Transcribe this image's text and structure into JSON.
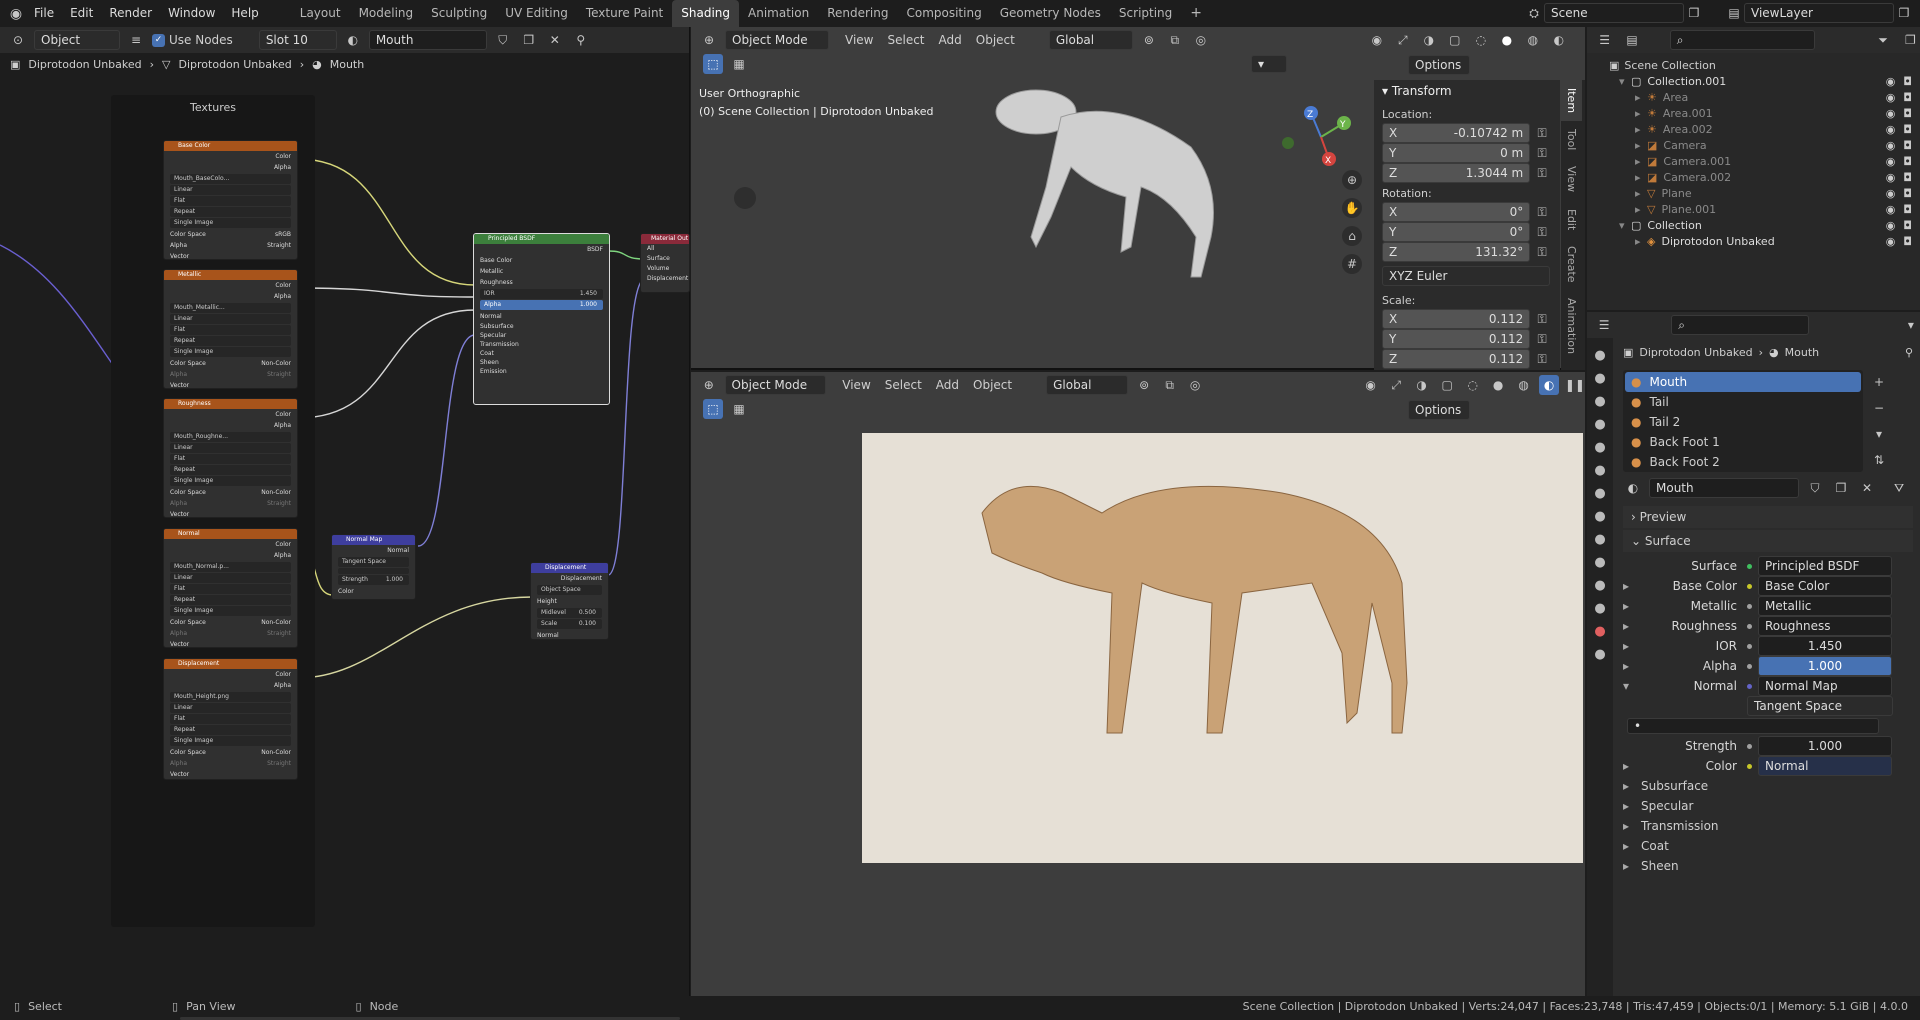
{
  "menu": [
    "File",
    "Edit",
    "Render",
    "Window",
    "Help"
  ],
  "workspaces": [
    "Layout",
    "Modeling",
    "Sculpting",
    "UV Editing",
    "Texture Paint",
    "Shading",
    "Animation",
    "Rendering",
    "Compositing",
    "Geometry Nodes",
    "Scripting"
  ],
  "active_workspace": "Shading",
  "scene": "Scene",
  "view_layer": "ViewLayer",
  "node_editor": {
    "mode": "Object",
    "use_nodes": "Use Nodes",
    "slot": "Slot 10",
    "material": "Mouth",
    "breadcrumb": [
      "Diprotodon Unbaked",
      "Diprotodon Unbaked",
      "Mouth"
    ],
    "frame_label": "Textures",
    "tex_nodes": [
      {
        "title": "Base Color",
        "image": "Mouth_BaseColo...",
        "interp": "Linear",
        "proj": "Flat",
        "ext": "Repeat",
        "src": "Single Image",
        "cs_label": "Color Space",
        "cs": "sRGB",
        "alpha_label": "Alpha",
        "alpha": "Straight"
      },
      {
        "title": "Metallic",
        "image": "Mouth_Metallic...",
        "interp": "Linear",
        "proj": "Flat",
        "ext": "Repeat",
        "src": "Single Image",
        "cs_label": "Color Space",
        "cs": "Non-Color",
        "alpha_label": "Alpha",
        "alpha": "Straight"
      },
      {
        "title": "Roughness",
        "image": "Mouth_Roughne...",
        "interp": "Linear",
        "proj": "Flat",
        "ext": "Repeat",
        "src": "Single Image",
        "cs_label": "Color Space",
        "cs": "Non-Color",
        "alpha_label": "Alpha",
        "alpha": "Straight"
      },
      {
        "title": "Normal",
        "image": "Mouth_Normal.p...",
        "interp": "Linear",
        "proj": "Flat",
        "ext": "Repeat",
        "src": "Single Image",
        "cs_label": "Color Space",
        "cs": "Non-Color",
        "alpha_label": "Alpha",
        "alpha": "Straight"
      },
      {
        "title": "Displacement",
        "image": "Mouth_Height.png",
        "interp": "Linear",
        "proj": "Flat",
        "ext": "Repeat",
        "src": "Single Image",
        "cs_label": "Color Space",
        "cs": "Non-Color",
        "alpha_label": "Alpha",
        "alpha": "Straight"
      }
    ],
    "sock": {
      "color": "Color",
      "alpha": "Alpha",
      "vector": "Vector"
    },
    "bsdf": {
      "title": "Principled BSDF",
      "out": "BSDF",
      "inputs": [
        "Base Color",
        "Metallic",
        "Roughness"
      ],
      "ior_label": "IOR",
      "ior": "1.450",
      "alpha_label": "Alpha",
      "alpha": "1.000",
      "normal": "Normal",
      "panels": [
        "Subsurface",
        "Specular",
        "Transmission",
        "Coat",
        "Sheen",
        "Emission"
      ]
    },
    "matout": {
      "title": "Material Out",
      "inputs": [
        "All",
        "Surface",
        "Volume",
        "Displacement"
      ]
    },
    "normalmap": {
      "title": "Normal Map",
      "out": "Normal",
      "space": "Tangent Space",
      "strength_label": "Strength",
      "strength": "1.000",
      "color": "Color"
    },
    "disp": {
      "title": "Displacement",
      "out": "Displacement",
      "space": "Object Space",
      "inputs": [
        "Height"
      ],
      "mid_label": "Midlevel",
      "mid": "0.500",
      "scale_label": "Scale",
      "scale": "0.100",
      "normal": "Normal"
    }
  },
  "viewport_top": {
    "mode": "Object Mode",
    "menus": [
      "View",
      "Select",
      "Add",
      "Object"
    ],
    "orient": "Global",
    "options": "Options",
    "title": "User Orthographic",
    "subtitle": "(0) Scene Collection | Diprotodon Unbaked",
    "npanel": {
      "header": "Transform",
      "location": "Location:",
      "loc": [
        {
          "a": "X",
          "v": "-0.10742 m"
        },
        {
          "a": "Y",
          "v": "0 m"
        },
        {
          "a": "Z",
          "v": "1.3044 m"
        }
      ],
      "rotation": "Rotation:",
      "rot": [
        {
          "a": "X",
          "v": "0°"
        },
        {
          "a": "Y",
          "v": "0°"
        },
        {
          "a": "Z",
          "v": "131.32°"
        }
      ],
      "euler": "XYZ Euler",
      "scale": "Scale:",
      "scl": [
        {
          "a": "X",
          "v": "0.112"
        },
        {
          "a": "Y",
          "v": "0.112"
        },
        {
          "a": "Z",
          "v": "0.112"
        }
      ],
      "tabs": [
        "Item",
        "Tool",
        "View",
        "Edit",
        "Create",
        "Animation"
      ]
    }
  },
  "viewport_bottom": {
    "mode": "Object Mode",
    "menus": [
      "View",
      "Select",
      "Add",
      "Object"
    ],
    "orient": "Global",
    "options": "Options"
  },
  "outliner": {
    "root": "Scene Collection",
    "items": [
      {
        "name": "Collection.001",
        "lvl": 1,
        "type": "coll"
      },
      {
        "name": "Area",
        "lvl": 2,
        "type": "light"
      },
      {
        "name": "Area.001",
        "lvl": 2,
        "type": "light"
      },
      {
        "name": "Area.002",
        "lvl": 2,
        "type": "light"
      },
      {
        "name": "Camera",
        "lvl": 2,
        "type": "cam"
      },
      {
        "name": "Camera.001",
        "lvl": 2,
        "type": "cam"
      },
      {
        "name": "Camera.002",
        "lvl": 2,
        "type": "cam"
      },
      {
        "name": "Plane",
        "lvl": 2,
        "type": "mesh"
      },
      {
        "name": "Plane.001",
        "lvl": 2,
        "type": "mesh"
      },
      {
        "name": "Collection",
        "lvl": 1,
        "type": "coll"
      },
      {
        "name": "Diprotodon Unbaked",
        "lvl": 2,
        "type": "obj"
      }
    ]
  },
  "props": {
    "breadcrumb": [
      "Diprotodon Unbaked",
      "Mouth"
    ],
    "slots": [
      "Mouth",
      "Tail",
      "Tail 2",
      "Back Foot 1",
      "Back Foot 2"
    ],
    "material": "Mouth",
    "preview": "Preview",
    "surface_panel": "Surface",
    "rows": [
      {
        "label": "Surface",
        "value": "Principled BSDF",
        "dot": "#3fbf5f"
      },
      {
        "label": "Base Color",
        "value": "Base Color",
        "dot": "#c7c729"
      },
      {
        "label": "Metallic",
        "value": "Metallic",
        "dot": "#a1a1a1"
      },
      {
        "label": "Roughness",
        "value": "Roughness",
        "dot": "#a1a1a1"
      },
      {
        "label": "IOR",
        "value": "1.450",
        "dot": "#a1a1a1"
      },
      {
        "label": "Alpha",
        "value": "1.000",
        "dot": "#a1a1a1"
      },
      {
        "label": "Normal",
        "value": "Normal Map",
        "dot": "#6363c7"
      }
    ],
    "tangent": "Tangent Space",
    "strength_label": "Strength",
    "strength": "1.000",
    "color_label": "Color",
    "color_value": "Normal",
    "subpanels": [
      "Subsurface",
      "Specular",
      "Transmission",
      "Coat",
      "Sheen"
    ]
  },
  "status": {
    "select": "Select",
    "pan": "Pan View",
    "node": "Node",
    "right": "Scene Collection | Diprotodon Unbaked | Verts:24,047 | Faces:23,748 | Tris:47,459 | Objects:0/1 | Memory: 5.1 GiB | 4.0.0"
  },
  "colors": {
    "accent": "#4772b3",
    "tex_header": "#a8541b",
    "bsdf_header": "#3c7f3c",
    "vector_header": "#3e3e9e",
    "out_header": "#8a2a3a",
    "bg": "#1d1d1d"
  }
}
